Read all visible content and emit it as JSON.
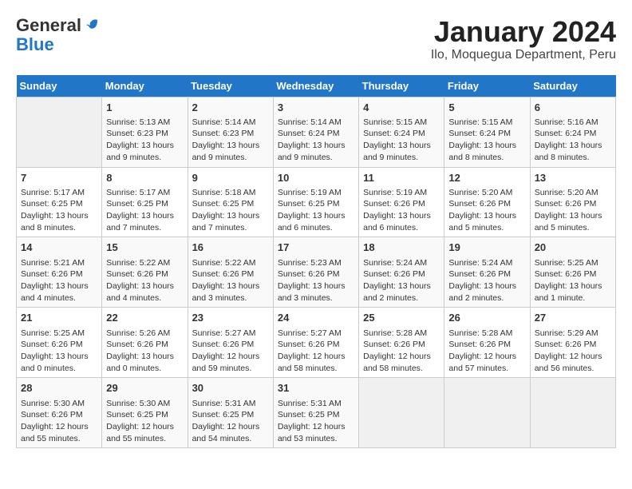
{
  "logo": {
    "line1": "General",
    "line2": "Blue"
  },
  "title": "January 2024",
  "subtitle": "Ilo, Moquegua Department, Peru",
  "days_of_week": [
    "Sunday",
    "Monday",
    "Tuesday",
    "Wednesday",
    "Thursday",
    "Friday",
    "Saturday"
  ],
  "weeks": [
    [
      {
        "day": "",
        "info": ""
      },
      {
        "day": "1",
        "info": "Sunrise: 5:13 AM\nSunset: 6:23 PM\nDaylight: 13 hours\nand 9 minutes."
      },
      {
        "day": "2",
        "info": "Sunrise: 5:14 AM\nSunset: 6:23 PM\nDaylight: 13 hours\nand 9 minutes."
      },
      {
        "day": "3",
        "info": "Sunrise: 5:14 AM\nSunset: 6:24 PM\nDaylight: 13 hours\nand 9 minutes."
      },
      {
        "day": "4",
        "info": "Sunrise: 5:15 AM\nSunset: 6:24 PM\nDaylight: 13 hours\nand 9 minutes."
      },
      {
        "day": "5",
        "info": "Sunrise: 5:15 AM\nSunset: 6:24 PM\nDaylight: 13 hours\nand 8 minutes."
      },
      {
        "day": "6",
        "info": "Sunrise: 5:16 AM\nSunset: 6:24 PM\nDaylight: 13 hours\nand 8 minutes."
      }
    ],
    [
      {
        "day": "7",
        "info": "Sunrise: 5:17 AM\nSunset: 6:25 PM\nDaylight: 13 hours\nand 8 minutes."
      },
      {
        "day": "8",
        "info": "Sunrise: 5:17 AM\nSunset: 6:25 PM\nDaylight: 13 hours\nand 7 minutes."
      },
      {
        "day": "9",
        "info": "Sunrise: 5:18 AM\nSunset: 6:25 PM\nDaylight: 13 hours\nand 7 minutes."
      },
      {
        "day": "10",
        "info": "Sunrise: 5:19 AM\nSunset: 6:25 PM\nDaylight: 13 hours\nand 6 minutes."
      },
      {
        "day": "11",
        "info": "Sunrise: 5:19 AM\nSunset: 6:26 PM\nDaylight: 13 hours\nand 6 minutes."
      },
      {
        "day": "12",
        "info": "Sunrise: 5:20 AM\nSunset: 6:26 PM\nDaylight: 13 hours\nand 5 minutes."
      },
      {
        "day": "13",
        "info": "Sunrise: 5:20 AM\nSunset: 6:26 PM\nDaylight: 13 hours\nand 5 minutes."
      }
    ],
    [
      {
        "day": "14",
        "info": "Sunrise: 5:21 AM\nSunset: 6:26 PM\nDaylight: 13 hours\nand 4 minutes."
      },
      {
        "day": "15",
        "info": "Sunrise: 5:22 AM\nSunset: 6:26 PM\nDaylight: 13 hours\nand 4 minutes."
      },
      {
        "day": "16",
        "info": "Sunrise: 5:22 AM\nSunset: 6:26 PM\nDaylight: 13 hours\nand 3 minutes."
      },
      {
        "day": "17",
        "info": "Sunrise: 5:23 AM\nSunset: 6:26 PM\nDaylight: 13 hours\nand 3 minutes."
      },
      {
        "day": "18",
        "info": "Sunrise: 5:24 AM\nSunset: 6:26 PM\nDaylight: 13 hours\nand 2 minutes."
      },
      {
        "day": "19",
        "info": "Sunrise: 5:24 AM\nSunset: 6:26 PM\nDaylight: 13 hours\nand 2 minutes."
      },
      {
        "day": "20",
        "info": "Sunrise: 5:25 AM\nSunset: 6:26 PM\nDaylight: 13 hours\nand 1 minute."
      }
    ],
    [
      {
        "day": "21",
        "info": "Sunrise: 5:25 AM\nSunset: 6:26 PM\nDaylight: 13 hours\nand 0 minutes."
      },
      {
        "day": "22",
        "info": "Sunrise: 5:26 AM\nSunset: 6:26 PM\nDaylight: 13 hours\nand 0 minutes."
      },
      {
        "day": "23",
        "info": "Sunrise: 5:27 AM\nSunset: 6:26 PM\nDaylight: 12 hours\nand 59 minutes."
      },
      {
        "day": "24",
        "info": "Sunrise: 5:27 AM\nSunset: 6:26 PM\nDaylight: 12 hours\nand 58 minutes."
      },
      {
        "day": "25",
        "info": "Sunrise: 5:28 AM\nSunset: 6:26 PM\nDaylight: 12 hours\nand 58 minutes."
      },
      {
        "day": "26",
        "info": "Sunrise: 5:28 AM\nSunset: 6:26 PM\nDaylight: 12 hours\nand 57 minutes."
      },
      {
        "day": "27",
        "info": "Sunrise: 5:29 AM\nSunset: 6:26 PM\nDaylight: 12 hours\nand 56 minutes."
      }
    ],
    [
      {
        "day": "28",
        "info": "Sunrise: 5:30 AM\nSunset: 6:26 PM\nDaylight: 12 hours\nand 55 minutes."
      },
      {
        "day": "29",
        "info": "Sunrise: 5:30 AM\nSunset: 6:25 PM\nDaylight: 12 hours\nand 55 minutes."
      },
      {
        "day": "30",
        "info": "Sunrise: 5:31 AM\nSunset: 6:25 PM\nDaylight: 12 hours\nand 54 minutes."
      },
      {
        "day": "31",
        "info": "Sunrise: 5:31 AM\nSunset: 6:25 PM\nDaylight: 12 hours\nand 53 minutes."
      },
      {
        "day": "",
        "info": ""
      },
      {
        "day": "",
        "info": ""
      },
      {
        "day": "",
        "info": ""
      }
    ]
  ]
}
